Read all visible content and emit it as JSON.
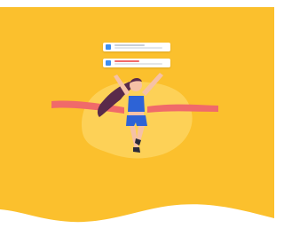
{
  "illustration": {
    "subject": "runner-crossing-finish-line",
    "colors": {
      "background": "#fbc02d",
      "blob": "#fdd35c",
      "ribbon": "#f06a6a",
      "hair": "#5a2a4a",
      "skin": "#f6c1a6",
      "top": "#2d63d6",
      "shorts": "#2d63d6",
      "task_check": "#3d8ef0"
    },
    "task_cards": [
      {
        "checked": true
      },
      {
        "checked": true
      }
    ]
  }
}
